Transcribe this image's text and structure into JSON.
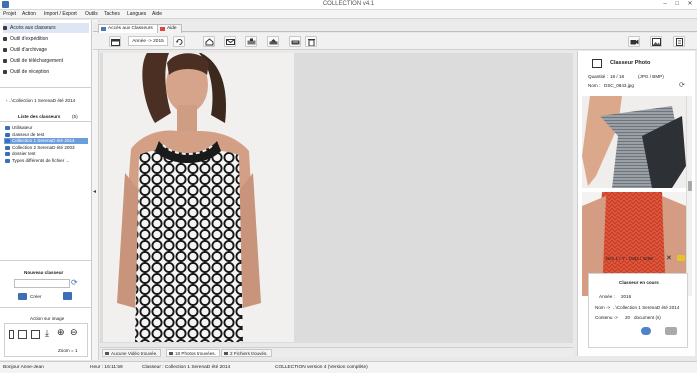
{
  "window": {
    "title": "COLLECTION v4.1"
  },
  "menu": [
    "Projet",
    "Action",
    "Import / Export",
    "Outils",
    "Taches",
    "Langues",
    "Aide"
  ],
  "nav": [
    {
      "label": "Accès aux classeurs",
      "icon": "binder-icon"
    },
    {
      "label": "Outil d'expédition",
      "icon": "ship-icon"
    },
    {
      "label": "Outil d'archivage",
      "icon": "archive-icon"
    },
    {
      "label": "Outil de téléchargement",
      "icon": "download-icon"
    },
    {
      "label": "Outil de réception",
      "icon": "receive-icon"
    }
  ],
  "collection_crumb": "..\\Collection 1 SerenaD été 2014",
  "classeurs": {
    "title": "Liste des classeurs",
    "count": "(5)",
    "items": [
      "Utilisateur",
      "classeur de test",
      "Collection 1 SerenaD été 2014",
      "Collection 2 SerenaD été 2003",
      "dossier test",
      "Types différents de fichier ..."
    ],
    "selected": 2
  },
  "nouveau": {
    "title": "Nouveau classeur",
    "create": "Créer"
  },
  "action_image": {
    "title": "Action sur image",
    "zoom": "Zoom = 1"
  },
  "tabs": [
    "Accès aux Classeurs",
    "Aide"
  ],
  "toolbar": {
    "year": "Année -> 2015"
  },
  "right": {
    "title": "Classeur Photo",
    "quantite_label": "Quantité :",
    "quantite_value": "18 / 18",
    "format": "(JPG / BMP)",
    "nom_label": "Nom :",
    "nom_value": "DSC_0843.jpg",
    "dim": "Dim 1 / Y : 1832 / 4256"
  },
  "encours": {
    "title": "Classeur en cours",
    "annee_label": "Année :",
    "annee_value": "2016",
    "nom_label": "Nom ->",
    "nom_value": "..\\Collection 1 SerenaD été 2014",
    "contenu_label": "Contenu ->",
    "contenu_value": "20",
    "contenu_unit": "document (s)"
  },
  "status_tabs": [
    "Aucune Vidéo trouvée.",
    "18 Photos trouvées.",
    "2 Fichiers trouvés."
  ],
  "statusbar": {
    "user": "Bonjour Anne-Jean",
    "heure": "Heur : 16:11:59",
    "classeur": "Classeur : Collection 1 SerenaD été 2014",
    "version": "COLLECTION version 4 (Version complète)"
  },
  "colors": {
    "accent": "#3d6fb5",
    "selection": "#6c9ddc",
    "panel": "#ffffff"
  }
}
